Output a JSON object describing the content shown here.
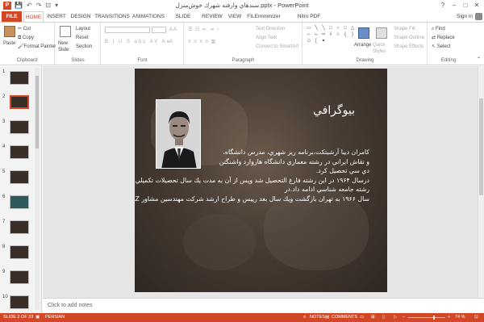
{
  "window": {
    "title": "ﺳﻨﺪﻫﺎﻱ ﻭﺍﺭﻓﺘﻪ ﺷﻬﺮﻙ ﺧﻮﺵﻣﻨﺰﻝ.pptx - PowerPoint",
    "controls": [
      "?",
      "–",
      "□",
      "✕"
    ]
  },
  "qat": [
    "💾",
    "↶",
    "↷",
    "⊡",
    "▾"
  ],
  "tabs": [
    "FILE",
    "HOME",
    "INSERT",
    "DESIGN",
    "TRANSITIONS",
    "ANIMATIONS",
    "SLIDE SHOW",
    "REVIEW",
    "VIEW",
    "FILEminimizer",
    "Nitro PDF Professional"
  ],
  "signin": "Sign in",
  "ribbon": {
    "clipboard": {
      "paste": "Paste",
      "cut": "Cut",
      "copy": "Copy",
      "format_painter": "Format Painter",
      "label": "Clipboard"
    },
    "slides": {
      "new_slide": "New Slide",
      "layout": "Layout",
      "reset": "Reset",
      "section": "Section",
      "label": "Slides"
    },
    "font": {
      "label": "Font"
    },
    "paragraph": {
      "text_direction": "Text Direction",
      "align_text": "Align Text",
      "convert": "Convert to SmartArt",
      "label": "Paragraph"
    },
    "drawing": {
      "arrange": "Arrange",
      "quick_styles": "Quick Styles",
      "shape_fill": "Shape Fill",
      "shape_outline": "Shape Outline",
      "shape_effects": "Shape Effects",
      "label": "Drawing"
    },
    "editing": {
      "find": "Find",
      "replace": "Replace",
      "select": "Select",
      "label": "Editing"
    }
  },
  "slides_panel": {
    "numbers": [
      "1",
      "2",
      "3",
      "4",
      "5",
      "6",
      "7",
      "8",
      "9",
      "10"
    ],
    "selected_index": 2
  },
  "slide": {
    "title": "بيوگرافي",
    "body": [
      "كامران ديبا آرشيتكت،برنامه ريز شهري، مدرس دانشگاه،",
      "و نقاش ايراني در رشته معماري دانشگاه هاروارد واشنگتن",
      "دي سي تحصيل كرد.",
      "درسال ۱۹۶۴ در اين رشته فارغ التحصيل شد وپس از آن به مدت يك سال تحصيلات تكميلي را در",
      "رشته جامعه شناسي ادامه داد.در",
      "سال ۱۹۶۶ به تهران بازگشت ويك سال بعد رييس و طراح ارشد شركت مهندسين مشاور DAZشد."
    ]
  },
  "notes_placeholder": "Click to add notes",
  "status": {
    "slide_info": "SLIDE 2 OF 33",
    "language": "PERSIAN",
    "notes": "NOTES",
    "comments": "COMMENTS",
    "zoom": "74 %"
  }
}
